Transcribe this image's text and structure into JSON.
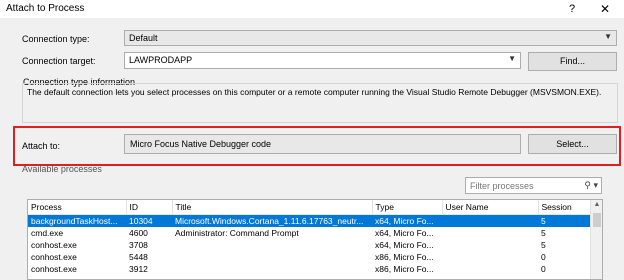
{
  "window": {
    "title": "Attach to Process",
    "help_label": "?",
    "close_label": "✕"
  },
  "connection_type": {
    "label": "Connection type:",
    "value": "Default"
  },
  "connection_target": {
    "label": "Connection target:",
    "value": "LAWPRODAPP",
    "find_label": "Find..."
  },
  "info": {
    "heading": "Connection type information",
    "text": "The default connection lets you select processes on this computer or a remote computer running the Visual Studio Remote Debugger (MSVSMON.EXE)."
  },
  "attach_to": {
    "label": "Attach to:",
    "value": "Micro Focus Native Debugger code",
    "select_label": "Select..."
  },
  "available": {
    "label": "Available processes",
    "filter_placeholder": "Filter processes"
  },
  "processes": {
    "columns": [
      "Process",
      "ID",
      "Title",
      "Type",
      "User Name",
      "Session"
    ],
    "rows": [
      {
        "process": "backgroundTaskHost...",
        "id": "10304",
        "title": "Microsoft.Windows.Cortana_1.11.6.17763_neutr...",
        "type": "x64, Micro Fo...",
        "user": "",
        "session": "5",
        "selected": true
      },
      {
        "process": "cmd.exe",
        "id": "4600",
        "title": "Administrator: Command Prompt",
        "type": "x64, Micro Fo...",
        "user": "",
        "session": "5"
      },
      {
        "process": "conhost.exe",
        "id": "3708",
        "title": "",
        "type": "x64, Micro Fo...",
        "user": "",
        "session": "5"
      },
      {
        "process": "conhost.exe",
        "id": "5448",
        "title": "",
        "type": "x86, Micro Fo...",
        "user": "",
        "session": "0"
      },
      {
        "process": "conhost.exe",
        "id": "3912",
        "title": "",
        "type": "x86, Micro Fo...",
        "user": "",
        "session": "0"
      }
    ]
  },
  "colors": {
    "accent": "#0078d7",
    "highlight_border": "#e02020"
  }
}
